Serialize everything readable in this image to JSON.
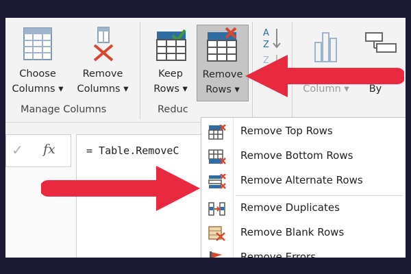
{
  "ribbon": {
    "choose_columns": {
      "line1": "Choose",
      "line2": "Columns ▾"
    },
    "remove_columns": {
      "line1": "Remove",
      "line2": "Columns ▾"
    },
    "keep_rows": {
      "line1": "Keep",
      "line2": "Rows ▾"
    },
    "remove_rows": {
      "line1": "Remove",
      "line2": "Rows ▾"
    },
    "group_column": {
      "label": "Column ▾"
    },
    "group_by": {
      "label": "By"
    },
    "groups": {
      "manage_columns": "Manage Columns",
      "reduce_rows": "Reduc"
    }
  },
  "formula_bar": {
    "check_symbol": "✓",
    "fx_symbol": "fx",
    "formula_text": "= Table.RemoveC",
    "brace_fragment": "{"
  },
  "remove_rows_menu": {
    "items": [
      {
        "label": "Remove Top Rows",
        "icon": "remove-top-rows-icon"
      },
      {
        "label": "Remove Bottom Rows",
        "icon": "remove-bottom-rows-icon"
      },
      {
        "label": "Remove Alternate Rows",
        "icon": "remove-alternate-rows-icon"
      },
      {
        "label": "Remove Duplicates",
        "icon": "remove-duplicates-icon"
      },
      {
        "label": "Remove Blank Rows",
        "icon": "remove-blank-rows-icon"
      },
      {
        "label": "Remove Errors",
        "icon": "remove-errors-icon"
      }
    ]
  },
  "colors": {
    "background": "#1c1a33",
    "arrow": "#e8293f",
    "accent_blue": "#2e6da4",
    "remove_red": "#d9472b",
    "keep_green": "#3a9b3a",
    "pressed_button": "#c5c5c5"
  }
}
